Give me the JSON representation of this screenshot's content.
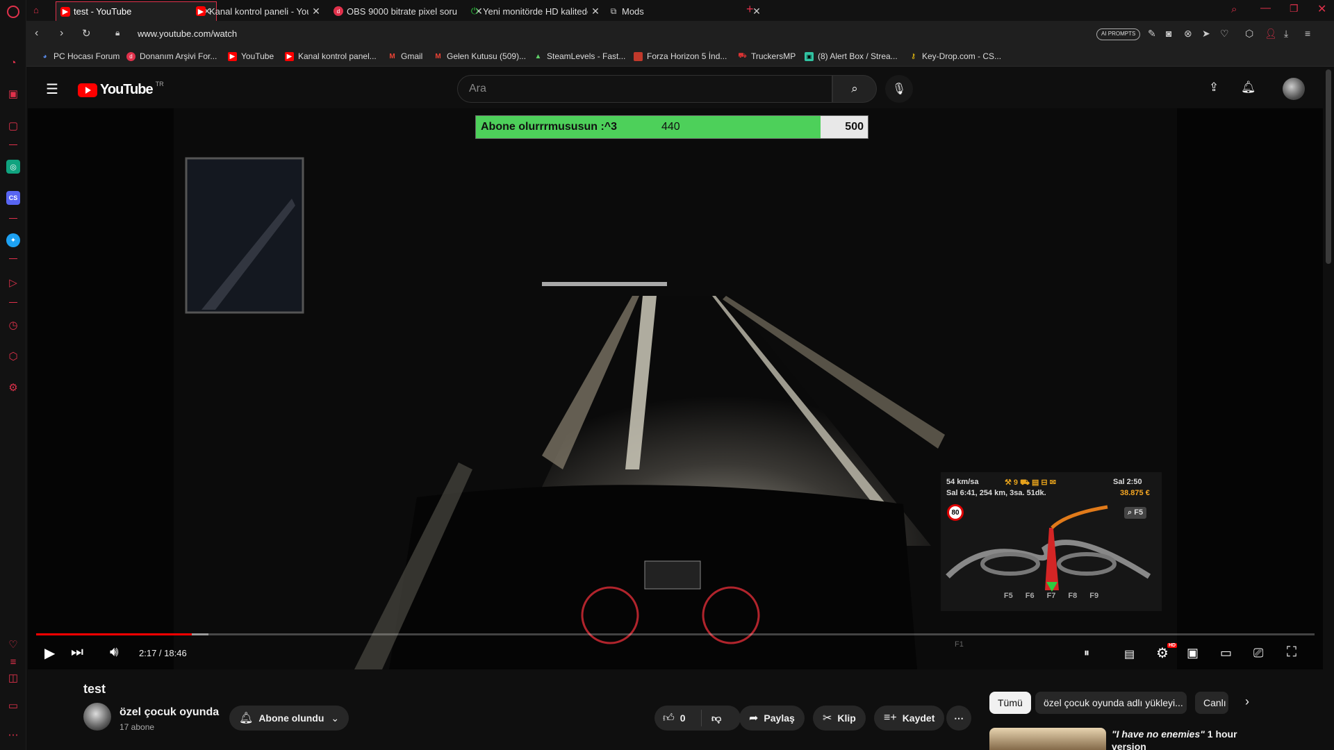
{
  "browser": {
    "tabs": [
      {
        "title": "test - YouTube",
        "icon": "youtube-icon",
        "active": true
      },
      {
        "title": "Kanal kontrol paneli - YouT",
        "icon": "youtube-icon",
        "active": false
      },
      {
        "title": "OBS 9000 bitrate pixel soru",
        "icon": "donanim-arsivi-icon",
        "active": false
      },
      {
        "title": "Yeni monitörde HD kalitede",
        "icon": "power-icon",
        "active": false
      },
      {
        "title": "Mods",
        "icon": "puzzle-icon",
        "active": false
      }
    ],
    "new_tab": "+",
    "url": "www.youtube.com/watch",
    "ai_prompts": "AI PROMPTS",
    "bookmarks": [
      {
        "label": "PC Hocası Forum",
        "icon": "pchocasi-icon"
      },
      {
        "label": "Donanım Arşivi For...",
        "icon": "donanim-arsivi-icon"
      },
      {
        "label": "YouTube",
        "icon": "youtube-icon"
      },
      {
        "label": "Kanal kontrol panel...",
        "icon": "youtube-icon"
      },
      {
        "label": "Gmail",
        "icon": "gmail-icon"
      },
      {
        "label": "Gelen Kutusu (509)...",
        "icon": "gmail-icon"
      },
      {
        "label": "SteamLevels - Fast...",
        "icon": "steamlevels-icon"
      },
      {
        "label": "Forza Horizon 5 İnd...",
        "icon": "forza-icon"
      },
      {
        "label": "TruckersMP",
        "icon": "truckersmp-icon"
      },
      {
        "label": "(8) Alert Box / Strea...",
        "icon": "streamlabs-icon"
      },
      {
        "label": "Key-Drop.com - CS...",
        "icon": "keydrop-icon"
      }
    ]
  },
  "youtube": {
    "logo_text": "YouTube",
    "country_code": "TR",
    "search_placeholder": "Ara",
    "video": {
      "overlay": {
        "goal_text": "Abone olurrrmususun :^3",
        "current": "440",
        "goal": "500",
        "progress_fraction": 0.88
      },
      "game_hud": {
        "speed": "54 km/sa",
        "time": "Sal 2:50",
        "eta": "Sal 6:41, 254 km, 3sa. 51dk.",
        "money": "38.875 €",
        "speed_limit": "80",
        "zoom_key": "F5",
        "fkeys": [
          "F5",
          "F6",
          "F7",
          "F8",
          "F9"
        ],
        "f1_label": "F1"
      },
      "time_display": "2:17 / 18:46",
      "played_fraction": 0.1217,
      "buffered_fraction": 0.135
    },
    "title": "test",
    "channel": {
      "name": "özel çocuk oyunda",
      "subscribers": "17 abone"
    },
    "subscribe_label": "Abone olundu",
    "like_count": "0",
    "share_label": "Paylaş",
    "clip_label": "Klip",
    "save_label": "Kaydet",
    "chips": [
      "Tümü",
      "özel çocuk oyunda adlı yükleyi...",
      "Canlı"
    ],
    "recommended": {
      "title_quote": "\"I have no enemies\"",
      "title_rest": " 1 hour version"
    }
  },
  "colors": {
    "accent": "#ff0000",
    "opera_red": "#e0314b",
    "progress_green": "#4dd05a"
  }
}
